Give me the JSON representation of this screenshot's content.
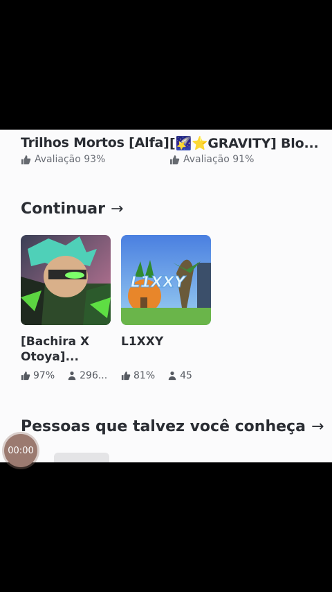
{
  "top_games": [
    {
      "title": "Trilhos Mortos [Alfa]",
      "rating": "Avaliação 93%"
    },
    {
      "title": "[🌠⭐GRAVITY] Blo...",
      "rating": "Avaliação 91%"
    }
  ],
  "continue_section": {
    "title": "Continuar",
    "games": [
      {
        "name_line1": "[Bachira X",
        "name_line2": "Otoya]...",
        "likes": "97%",
        "players": "296..."
      },
      {
        "name_line1": "L1XXY",
        "name_line2": "",
        "likes": "81%",
        "players": "45"
      }
    ]
  },
  "people_section": {
    "title": "Pessoas que talvez você conheça"
  },
  "recording": {
    "timer": "00:00"
  },
  "icons": {
    "like": "thumbs-up-icon",
    "players": "players-icon",
    "arrow": "arrow-right-icon"
  }
}
